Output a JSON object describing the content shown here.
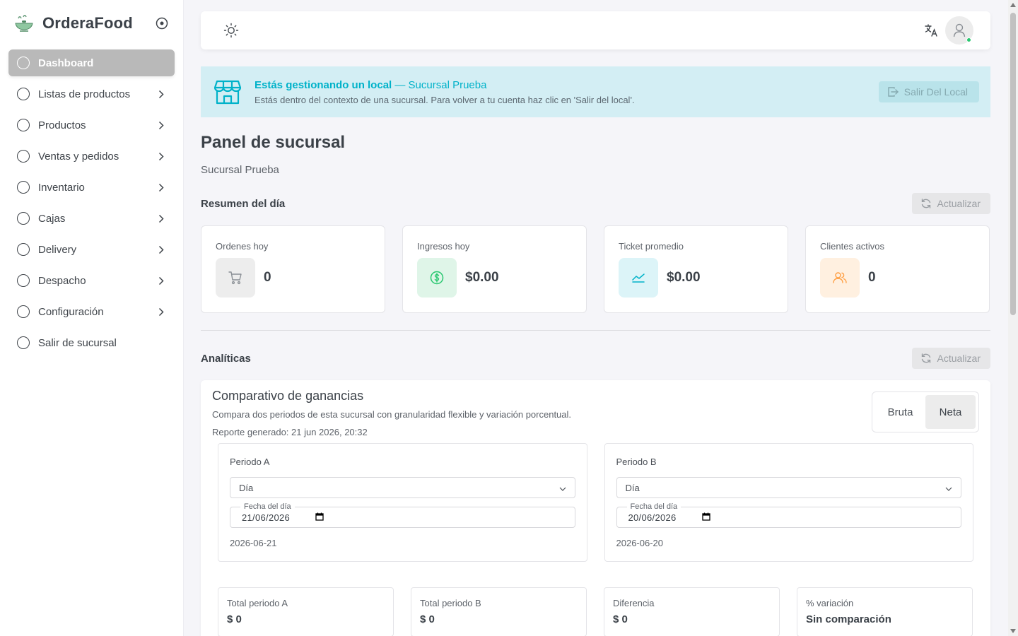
{
  "app": {
    "name": "OrderaFood"
  },
  "sidebar": {
    "items": [
      {
        "label": "Dashboard"
      },
      {
        "label": "Listas de productos"
      },
      {
        "label": "Productos"
      },
      {
        "label": "Ventas y pedidos"
      },
      {
        "label": "Inventario"
      },
      {
        "label": "Cajas"
      },
      {
        "label": "Delivery"
      },
      {
        "label": "Despacho"
      },
      {
        "label": "Configuración"
      },
      {
        "label": "Salir de sucursal"
      }
    ]
  },
  "banner": {
    "title": "Estás gestionando un local",
    "branch": "— Sucursal Prueba",
    "description": "Estás dentro del contexto de una sucursal. Para volver a tu cuenta haz clic en 'Salir del local'.",
    "exit_label": "Salir Del Local"
  },
  "page": {
    "title": "Panel de sucursal",
    "subtitle": "Sucursal Prueba"
  },
  "summary": {
    "title": "Resumen del día",
    "refresh_label": "Actualizar",
    "cards": [
      {
        "label": "Ordenes hoy",
        "value": "0"
      },
      {
        "label": "Ingresos hoy",
        "value": "$0.00"
      },
      {
        "label": "Ticket promedio",
        "value": "$0.00"
      },
      {
        "label": "Clientes activos",
        "value": "0"
      }
    ]
  },
  "analytics": {
    "title": "Analíticas",
    "refresh_label": "Actualizar",
    "comparison": {
      "title": "Comparativo de ganancias",
      "description": "Compara dos periodos de esta sucursal con granularidad flexible y variación porcentual.",
      "report": "Reporte generado: 21 jun 2026, 20:32",
      "toggle": {
        "gross": "Bruta",
        "net": "Neta",
        "selected": "Neta"
      },
      "period_a": {
        "label": "Periodo A",
        "granularity": "Día",
        "date_legend": "Fecha del día",
        "date_value": "21/06/2026",
        "iso": "2026-06-21"
      },
      "period_b": {
        "label": "Periodo B",
        "granularity": "Día",
        "date_legend": "Fecha del día",
        "date_value": "20/06/2026",
        "iso": "2026-06-20"
      },
      "totals": [
        {
          "label": "Total periodo A",
          "value": "$ 0"
        },
        {
          "label": "Total periodo B",
          "value": "$ 0"
        },
        {
          "label": "Diferencia",
          "value": "$ 0"
        },
        {
          "label": "% variación",
          "value": "Sin comparación"
        }
      ]
    }
  },
  "colors": {
    "accent_cyan": "#00b2c9",
    "success": "#28c76f",
    "active_menu": "#b9b9b9"
  },
  "icons": {
    "brand": "dish-icon",
    "theme": "sun-icon",
    "language": "translate-icon",
    "store": "store-icon"
  }
}
